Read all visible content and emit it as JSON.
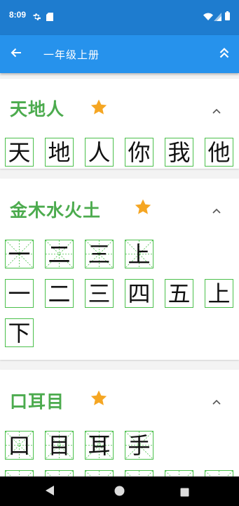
{
  "status_bar": {
    "time": "8:09"
  },
  "app_bar": {
    "title": "一年级上册"
  },
  "lessons": [
    {
      "title": "天地人",
      "rows": [
        [
          {
            "c": "天",
            "guide": false
          },
          {
            "c": "地",
            "guide": false
          },
          {
            "c": "人",
            "guide": false
          },
          {
            "c": "你",
            "guide": false
          },
          {
            "c": "我",
            "guide": false
          },
          {
            "c": "他",
            "guide": false
          }
        ]
      ]
    },
    {
      "title": "金木水火土",
      "rows": [
        [
          {
            "c": "一",
            "guide": true
          },
          {
            "c": "二",
            "guide": true
          },
          {
            "c": "三",
            "guide": true
          },
          {
            "c": "上",
            "guide": true
          }
        ],
        [
          {
            "c": "一",
            "guide": false
          },
          {
            "c": "二",
            "guide": false
          },
          {
            "c": "三",
            "guide": false
          },
          {
            "c": "四",
            "guide": false
          },
          {
            "c": "五",
            "guide": false
          },
          {
            "c": "上",
            "guide": false
          }
        ],
        [
          {
            "c": "下",
            "guide": false
          }
        ]
      ]
    },
    {
      "title": "口耳目",
      "rows": [
        [
          {
            "c": "口",
            "guide": true
          },
          {
            "c": "目",
            "guide": true
          },
          {
            "c": "耳",
            "guide": true
          },
          {
            "c": "手",
            "guide": true
          }
        ],
        [
          {
            "c": "",
            "guide": true
          },
          {
            "c": "",
            "guide": true
          },
          {
            "c": "",
            "guide": true
          },
          {
            "c": "",
            "guide": true
          },
          {
            "c": "",
            "guide": true
          },
          {
            "c": "",
            "guide": true
          }
        ]
      ]
    }
  ],
  "colors": {
    "status_bar": "#1e7ccf",
    "app_bar": "#2692ec",
    "title_green": "#4cab4e",
    "star": "#f5a623",
    "grid_green": "#4bc04b"
  },
  "icons": [
    "settings-icon",
    "sim-card-icon",
    "wifi-icon",
    "signal-icon",
    "battery-icon",
    "back-arrow-icon",
    "double-chevron-up-icon",
    "star-icon",
    "chevron-up-icon",
    "nav-back-icon",
    "nav-home-icon",
    "nav-recents-icon"
  ]
}
